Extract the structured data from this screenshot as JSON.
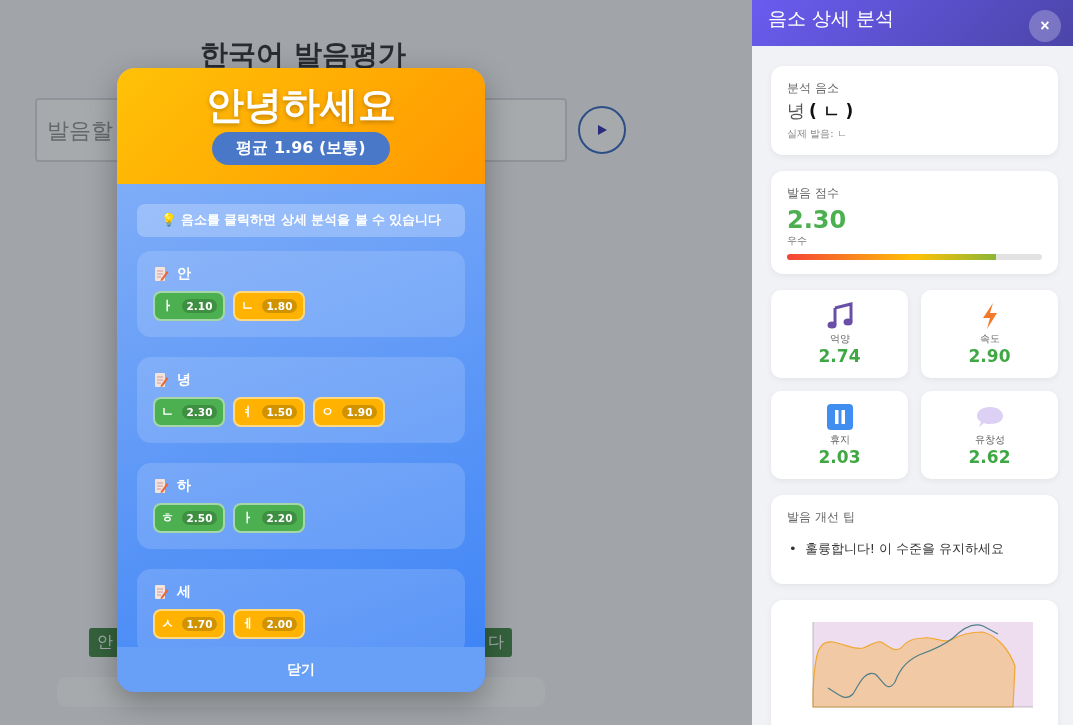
{
  "page": {
    "title": "한국어 발음평가",
    "input": {
      "placeholder": "발음할"
    },
    "result_bar": {
      "left_text": "안",
      "right_text": "다"
    }
  },
  "modal": {
    "word": "안녕하세요",
    "average": "평균 1.96 (보통)",
    "hint": "💡 음소를 클릭하면 상세 분석을 볼 수 있습니다",
    "syllables": [
      {
        "syllable": "안",
        "phonemes": [
          {
            "symbol": "ㅏ",
            "score": "2.10",
            "color": "#4caf50"
          },
          {
            "symbol": "ㄴ",
            "score": "1.80",
            "color": "#ffb300"
          }
        ]
      },
      {
        "syllable": "녕",
        "phonemes": [
          {
            "symbol": "ㄴ",
            "score": "2.30",
            "color": "#4caf50"
          },
          {
            "symbol": "ㅕ",
            "score": "1.50",
            "color": "#ffb300"
          },
          {
            "symbol": "ㅇ",
            "score": "1.90",
            "color": "#ffb300"
          }
        ]
      },
      {
        "syllable": "하",
        "phonemes": [
          {
            "symbol": "ㅎ",
            "score": "2.50",
            "color": "#4caf50"
          },
          {
            "symbol": "ㅏ",
            "score": "2.20",
            "color": "#4caf50"
          }
        ]
      },
      {
        "syllable": "세",
        "phonemes": [
          {
            "symbol": "ㅅ",
            "score": "1.70",
            "color": "#ffb300"
          },
          {
            "symbol": "ㅔ",
            "score": "2.00",
            "color": "#ffb300"
          }
        ]
      }
    ],
    "close": "닫기"
  },
  "panel": {
    "title": "음소 상세 분석",
    "close": "×",
    "phoneme": {
      "label": "분석 음소",
      "syllable": "녕",
      "symbol": "( ㄴ )",
      "actual": "실제 발음: ㄴ"
    },
    "score": {
      "label": "발음 점수",
      "value": "2.30",
      "grade": "우수",
      "level": 0.82
    },
    "metrics": [
      {
        "kind": "music",
        "label": "억양",
        "value": "2.74"
      },
      {
        "kind": "bolt",
        "label": "속도",
        "value": "2.90"
      },
      {
        "kind": "pause",
        "label": "휴지",
        "value": "2.03"
      },
      {
        "kind": "speech",
        "label": "유창성",
        "value": "2.62"
      }
    ],
    "tips": {
      "title": "발음 개선 팁",
      "items": [
        {
          "marker": "•",
          "text": "훌륭합니다! 이 수준을 유지하세요"
        }
      ]
    }
  }
}
